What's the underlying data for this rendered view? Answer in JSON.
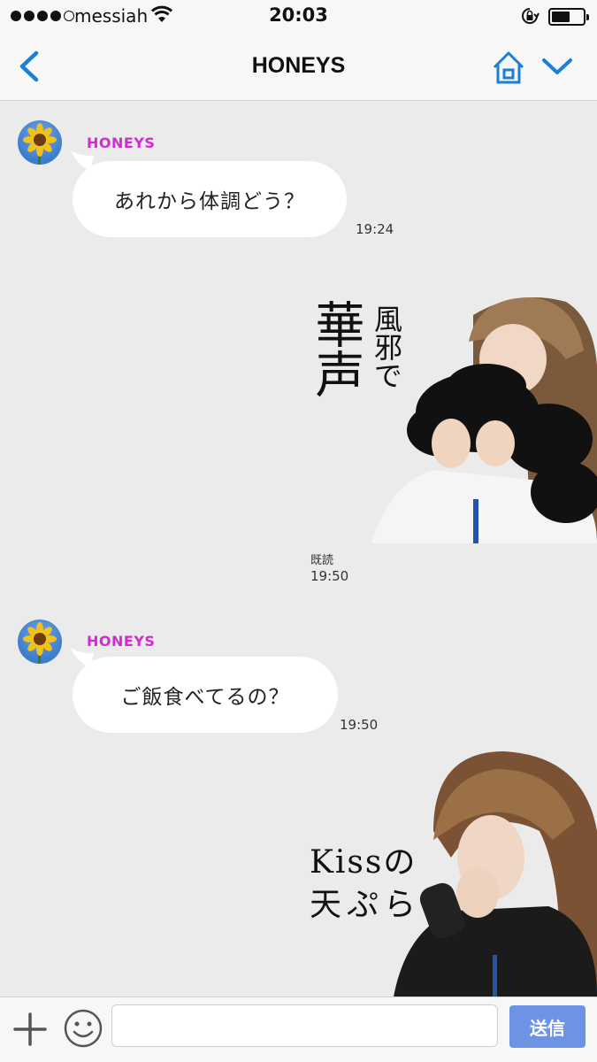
{
  "status_bar": {
    "carrier": "messiah",
    "time": "20:03",
    "signal_bars": 4,
    "signal_total": 5
  },
  "nav": {
    "title": "HONEYS",
    "back_icon": "chevron-left-icon",
    "home_icon": "home-icon",
    "menu_icon": "chevron-down-icon",
    "accent": "#1a7fd6"
  },
  "messages": [
    {
      "type": "text",
      "side": "left",
      "sender": "HONEYS",
      "text": "あれから体調どう？",
      "time": "19:24"
    },
    {
      "type": "sticker",
      "side": "right",
      "text_large": "華声",
      "text_small": "風邪で",
      "read": "既読",
      "time": "19:50"
    },
    {
      "type": "text",
      "side": "left",
      "sender": "HONEYS",
      "text": "ご飯食べてるの？",
      "time": "19:50"
    },
    {
      "type": "sticker",
      "side": "right",
      "line1": "Kissの",
      "line2": "天ぷら"
    }
  ],
  "input_bar": {
    "placeholder": "",
    "send_label": "送信",
    "send_color": "#6d94e4"
  },
  "colors": {
    "sender_name": "#d52ad3",
    "background": "#ebebeb"
  }
}
